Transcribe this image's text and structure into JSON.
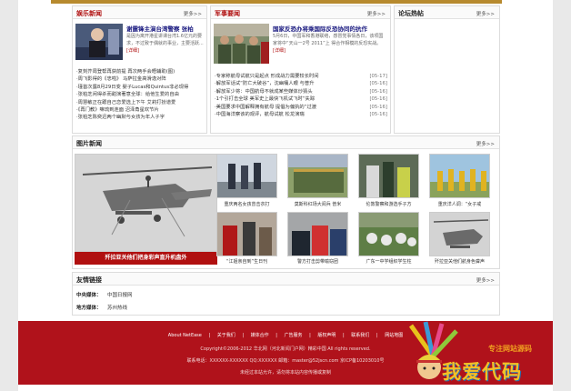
{
  "colors": {
    "accent": "#b01010",
    "footer_bg": "#b0121b",
    "link": "#1a1a80"
  },
  "ent": {
    "title": "娱乐新闻",
    "more": "更多>>",
    "headline": "谢霆锋主演台湾警察 张柏",
    "summary": "是因为离开港星讲课台湾1.6亿元的要求，不过致于偶就的事业，主要活跃...",
    "detail": "[详细]",
    "items": [
      "·复刻芥周登帮再获前提 再次两手会晤辅助(图)",
      "·周飞影得的《忠啦》 马萨拉金高滑逸对阵",
      "·瑾首次露8月29日变 婴子Lucas和Quintus非必现得",
      "·张柏芝闲得杀而甜演著意全球：给他生爱的自由",
      "·周慧敏正在跟自己恋爱选上下午 艾莉打扮道爱",
      "·《再门教》嘛琉到连面 沼泽角星欢节片",
      "·张柏芝陈奕迅两个幽默与女孩为年人子字"
    ]
  },
  "mil": {
    "title": "军事要闻",
    "more": "更多>>",
    "headline": "国家反恐办将乘国际反恐协同的抗作",
    "summary": "5月6日，中国军和香港联络，感冒党事情各日，该项国家将中“天山一2号 2011”上 得合作相模的反恐实战。",
    "detail": "[详细]",
    "items": [
      {
        "text": "·专家称航母试航只是起点 形成战力需要较长时间",
        "date": "[05-17]"
      },
      {
        "text": "·解放军话试“防亡大破谷”，沈幽桶人眼 与普升",
        "date": "[05-16]"
      },
      {
        "text": "·解放军少将：中国航母不就成某些媒体炒猜头",
        "date": "[05-16]"
      },
      {
        "text": "·1个引打击全球 美军史上最快飞机试飞时“失踪",
        "date": "[05-16]"
      },
      {
        "text": "·美国要求中国解释拥有航母 提倡为偏执的“过渡",
        "date": "[05-16]"
      },
      {
        "text": "·中国海洋察该的观评，航母试航 松龙演瑞",
        "date": "[05-16]"
      }
    ]
  },
  "forum": {
    "title": "论坛热帖",
    "more": "更多>>"
  },
  "pics": {
    "title": "图片新闻",
    "more": "更多>>",
    "big_caption": "歼拉亚关他们把身彩声直升机盘外",
    "captions": [
      "重庆两名女孩曾击衣打",
      "莫斯科红场大阅兵 普米",
      "伦敦警察和游选手子方",
      "重庆洋人调：“女子戒",
      "“江姐亲自到”生日刊",
      "警方打击剪带喻窃团",
      "广东一中学组织学生柱",
      "歼拉亚关他们航身色聋声"
    ]
  },
  "links": {
    "title": "友情链接",
    "more": "更多>>",
    "central_label": "中央媒体：",
    "central_value": "中国日报网",
    "local_label": "地方媒体：",
    "local_value": "苏州热线"
  },
  "footer": {
    "nav": [
      "About NetEase",
      "|",
      "关于我们",
      "|",
      "媒体合作",
      "|",
      "广告服务",
      "|",
      "版权声明",
      "|",
      "联系我们",
      "|",
      "网站地图"
    ],
    "copyright": "Copyright©2006-2012 华北网（河北新闻门户网）精彩中国 All rights reserved.",
    "contact": "联系电话：XXXXXX-XXXXXX QQ:XXXXXX 邮箱：master@52jscn.com 京ICP备10203010号",
    "notice": "未经过本站允许，请勿将本站内容传播或复制"
  },
  "watermark": {
    "sub": "专注网站源码",
    "main": "我爱代码"
  }
}
